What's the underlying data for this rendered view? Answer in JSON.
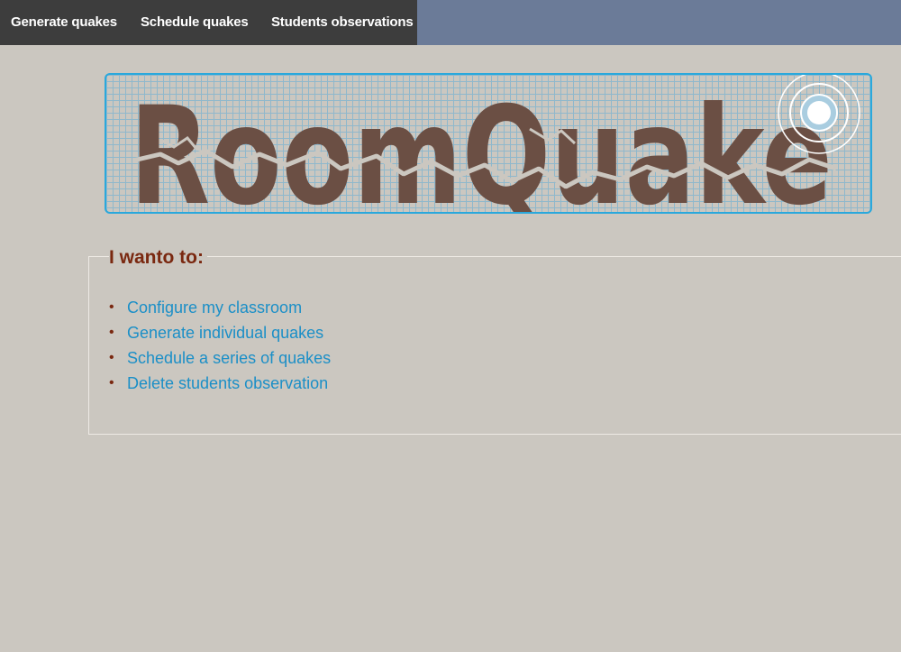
{
  "nav": {
    "items": [
      {
        "label": "Generate quakes"
      },
      {
        "label": "Schedule quakes"
      },
      {
        "label": "Students observations"
      }
    ]
  },
  "banner": {
    "logo_text": "RoomQuake",
    "colors": {
      "letters": "#6b4f44",
      "border": "#2aa8dc",
      "grid": "#8fb8cc"
    }
  },
  "menu": {
    "heading": "I wanto to:",
    "options": [
      {
        "label": "Configure my classroom"
      },
      {
        "label": "Generate individual quakes"
      },
      {
        "label": "Schedule a series of quakes"
      },
      {
        "label": "Delete students observation"
      }
    ]
  },
  "colors": {
    "background": "#cbc7c0",
    "nav_bg": "#3d3d3d",
    "topbar_bg": "#6b7b98",
    "heading": "#7a2810",
    "link": "#1b8fc7"
  }
}
